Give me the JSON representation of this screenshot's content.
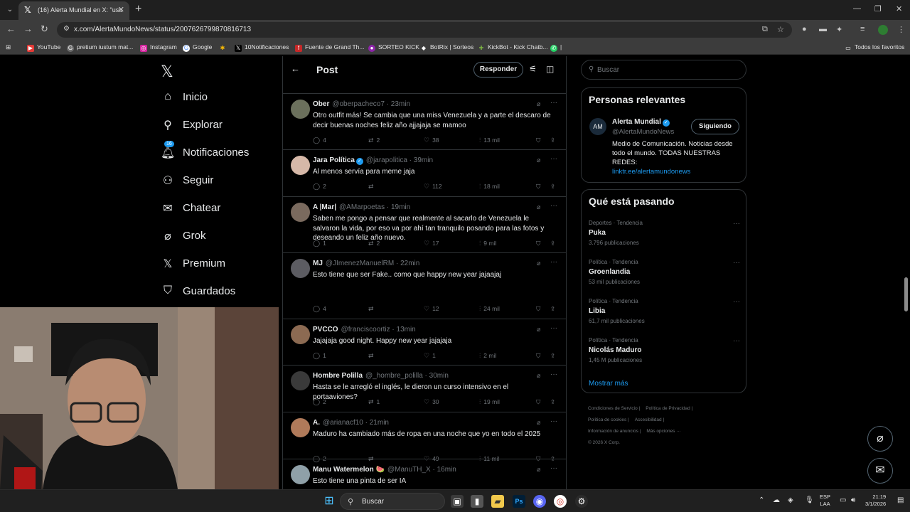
{
  "browser": {
    "tab_title": "(16) Alerta Mundial en X: \"usu",
    "url": "x.com/AlertaMundoNews/status/2007626799870816713",
    "bookmarks": [
      "YouTube",
      "pretium iustum mat...",
      "Instagram",
      "Google",
      "",
      "10Notificaciones",
      "Fuente de Grand Th...",
      "SORTEO KICK",
      "BotRix | Sorteos",
      "KickBot - Kick Chatb...",
      ""
    ],
    "all_bookmarks": "Todos los favoritos"
  },
  "nav": {
    "items": [
      {
        "label": "Inicio",
        "icon": "home-icon"
      },
      {
        "label": "Explorar",
        "icon": "search-icon"
      },
      {
        "label": "Notificaciones",
        "icon": "bell-icon",
        "badge": "16"
      },
      {
        "label": "Seguir",
        "icon": "follow-icon"
      },
      {
        "label": "Chatear",
        "icon": "mail-icon"
      },
      {
        "label": "Grok",
        "icon": "grok-icon"
      },
      {
        "label": "Premium",
        "icon": "x-icon"
      },
      {
        "label": "Guardados",
        "icon": "bookmark-icon"
      }
    ]
  },
  "header": {
    "title": "Post",
    "reply_button": "Responder"
  },
  "tweets": [
    {
      "name": "Ober",
      "handle": "@oberpacheco7 · 23min",
      "text": "Otro outfit más! Se cambia que una miss Venezuela y a parte el descaro de decir buenas noches feliz año ajjajaja se mamoo",
      "replies": "4",
      "reposts": "2",
      "likes": "38",
      "views": "13 mil",
      "avatar_color": "#6b705c"
    },
    {
      "name": "Jara Política",
      "verified": true,
      "handle": "@jarapolitica · 39min",
      "text": "Al menos servía para meme jaja",
      "replies": "2",
      "reposts": "",
      "likes": "112",
      "views": "18 mil",
      "avatar_color": "#d6b8a8"
    },
    {
      "name": "A |Mar|",
      "handle": "@AMarpoetas · 19min",
      "text": "Saben me pongo a pensar que realmente al sacarlo de Venezuela le salvaron la vida, por eso va por ahí tan tranquilo posando para las fotos y deseando un feliz año nuevo.",
      "replies": "1",
      "reposts": "2",
      "likes": "17",
      "views": "9 mil",
      "avatar_color": "#7a6a5e"
    },
    {
      "name": "MJ",
      "handle": "@JImenezManuelRM · 22min",
      "text": "Esto tiene que ser Fake.. como que happy new year jajaajaj",
      "replies": "4",
      "reposts": "",
      "likes": "12",
      "views": "24 mil",
      "avatar_color": "#5c5c62"
    },
    {
      "name": "PVCCO",
      "handle": "@franciscoortiz · 13min",
      "text": "Jajajaja good night. Happy new year jajajaja",
      "replies": "1",
      "reposts": "",
      "likes": "1",
      "views": "2 mil",
      "avatar_color": "#8c6a52"
    },
    {
      "name": "Hombre Polilla",
      "handle": "@_hombre_polilla · 30min",
      "text": "Hasta se le arregló el inglés, le dieron un curso intensivo en el portaaviones?",
      "replies": "2",
      "reposts": "1",
      "likes": "30",
      "views": "19 mil",
      "avatar_color": "#3a3a3a"
    },
    {
      "name": "A.",
      "handle": "@arianacf10 · 21min",
      "text": "Maduro ha cambiado más de ropa en una noche que yo en todo el 2025",
      "replies": "2",
      "reposts": "",
      "likes": "49",
      "views": "11 mil",
      "avatar_color": "#b07a5a"
    },
    {
      "name": "Manu Watermelon 🍉",
      "handle": "@ManuTH_X · 16min",
      "text": "Esto tiene una pinta de ser IA",
      "replies": "",
      "reposts": "",
      "likes": "",
      "views": "",
      "avatar_color": "#8fa0a8"
    }
  ],
  "right": {
    "search_placeholder": "Buscar",
    "relevant_title": "Personas relevantes",
    "account_name": "Alerta Mundial",
    "account_handle": "@AlertaMundoNews",
    "following_button": "Siguiendo",
    "bio": "Medio de Comunicación. Noticias desde todo el mundo. TODAS NUESTRAS REDES:",
    "bio_link": "linktr.ee/alertamundonews",
    "trending_title": "Qué está pasando",
    "trends": [
      {
        "category": "Deportes · Tendencia",
        "name": "Puka",
        "posts": "3.796 publicaciones"
      },
      {
        "category": "Política · Tendencia",
        "name": "Groenlandia",
        "posts": "53 mil publicaciones"
      },
      {
        "category": "Política · Tendencia",
        "name": "Libia",
        "posts": "61,7 mil publicaciones"
      },
      {
        "category": "Política · Tendencia",
        "name": "Nicolás Maduro",
        "posts": "1,45 M publicaciones"
      }
    ],
    "show_more": "Mostrar más",
    "footer": [
      "Condiciones de Servicio |",
      "Política de Privacidad |",
      "Política de cookies |",
      "Accesibilidad |",
      "Información de anuncios |",
      "Más opciones ···",
      "© 2026 X Corp."
    ]
  },
  "taskbar": {
    "search": "Buscar",
    "lang_top": "ESP",
    "lang_bottom": "LAA",
    "time": "21:19",
    "date": "3/1/2026"
  },
  "colors": {
    "accent": "#1d9bf0",
    "background": "#000000",
    "border": "#2f3336",
    "muted": "#71767b"
  }
}
